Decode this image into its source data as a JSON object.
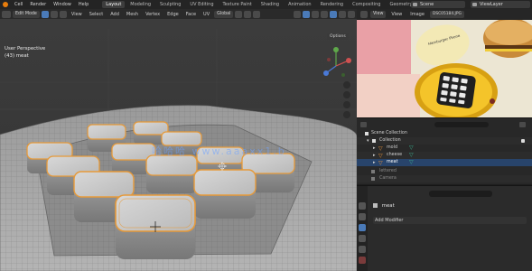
{
  "topbar": {
    "menus": [
      "Cell",
      "Render",
      "Window",
      "Help"
    ],
    "workspaces": [
      {
        "label": "Layout",
        "active": true
      },
      {
        "label": "Modeling",
        "active": false
      },
      {
        "label": "Sculpting",
        "active": false
      },
      {
        "label": "UV Editing",
        "active": false
      },
      {
        "label": "Texture Paint",
        "active": false
      },
      {
        "label": "Shading",
        "active": false
      },
      {
        "label": "Animation",
        "active": false
      },
      {
        "label": "Rendering",
        "active": false
      },
      {
        "label": "Compositing",
        "active": false
      },
      {
        "label": "Geometry Nodes",
        "active": false
      }
    ],
    "scene": "Scene",
    "view_layer": "ViewLayer"
  },
  "viewport_header": {
    "mode": "Edit Mode",
    "menus": [
      "View",
      "Select",
      "Add",
      "Mesh",
      "Vertex",
      "Edge",
      "Face",
      "UV"
    ],
    "transform_orientation": "Global",
    "options": "Options"
  },
  "viewport_info": {
    "view_name": "User Perspective",
    "object_line": "(43) meat"
  },
  "watermark": "哈哈哈 www.aaaxx1.b",
  "render_header": {
    "view_label": "View",
    "view_menu": "View",
    "image_menu": "Image",
    "image_name": "DSC05184.JPG"
  },
  "outliner": {
    "root": "Scene Collection",
    "collection": "Collection",
    "items": [
      {
        "name": "mold",
        "selected": false
      },
      {
        "name": "cheese",
        "selected": false
      },
      {
        "name": "meat",
        "selected": true
      }
    ],
    "extra": [
      "lettered",
      "Camera"
    ]
  },
  "properties": {
    "object_name": "meat",
    "add_modifier": "Add Modifier"
  },
  "colors": {
    "selection_orange": "#e69a3a",
    "ui_blue": "#4a7ab8",
    "selected_row": "#28446b"
  }
}
